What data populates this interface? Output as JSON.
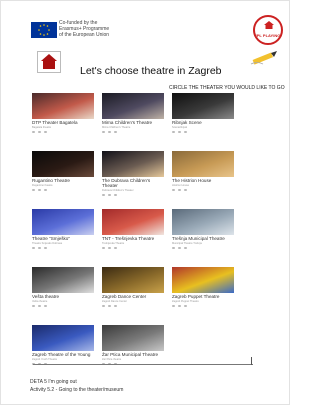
{
  "header": {
    "eu_text_lines": [
      "Co-funded by the",
      "Erasmus+ Programme",
      "of the European Union"
    ],
    "ipl_text": "IPL PLAYING",
    "title": "Let's choose theatre in Zagreb",
    "instruction": "CIRCLE THE THEATER YOU WOULD LIKE TO GO"
  },
  "theatres": [
    {
      "label": "DTP Theater Bagatela",
      "sub": "Bagatela theatre",
      "colors": [
        "#4a2a2a",
        "#c25a4a",
        "#e9d8c8"
      ]
    },
    {
      "label": "Mirna Children's Theatre",
      "sub": "Mirna Children's Theatre",
      "colors": [
        "#1b1b24",
        "#4f4a60",
        "#bfb2a6"
      ]
    },
    {
      "label": "Ribnjak Scene",
      "sub": "Scenaribnjak",
      "colors": [
        "#0f0f0f",
        "#3a3a3a",
        "#8a8a8a"
      ]
    },
    {
      "label": "Rugantino Theatre",
      "sub": "Rugantino theatre",
      "colors": [
        "#0a0a0a",
        "#2a1a14",
        "#6a4a3a"
      ]
    },
    {
      "label": "The Dubrava Children's Theater",
      "sub": "Dubrava Children's Theater",
      "colors": [
        "#111018",
        "#6b5c52",
        "#e6c89a"
      ]
    },
    {
      "label": "The Histrion House",
      "sub": "Histrion House",
      "colors": [
        "#8a6a3a",
        "#c79a55",
        "#e8c48a"
      ]
    },
    {
      "label": "Theatre \"Smješko\"",
      "sub": "Theatre Smjesko Dubrava",
      "colors": [
        "#2a3aa6",
        "#5c6fd8",
        "#c9cff0"
      ]
    },
    {
      "label": "TNT - Trešnjevka Theatre",
      "sub": "Trešnjevka Theatre",
      "colors": [
        "#a22a2a",
        "#d85a4a",
        "#f0e6e0"
      ]
    },
    {
      "label": "Trešnja Municipal Theatre",
      "sub": "Municipal Theatre Trešnja",
      "colors": [
        "#5a6a7a",
        "#9aaab8",
        "#dde4ea"
      ]
    },
    {
      "label": "Vešta theatre",
      "sub": "Vešta theatre",
      "colors": [
        "#2a2a2a",
        "#777777",
        "#e0e0e0"
      ]
    },
    {
      "label": "Zagreb Dance Center",
      "sub": "Zagreb Dance Center",
      "colors": [
        "#3a2a12",
        "#8a6a2a",
        "#c9a24a"
      ]
    },
    {
      "label": "Zagreb Puppet Theatre",
      "sub": "Zagreb Puppet Theatre",
      "colors": [
        "#b0362a",
        "#e8c020",
        "#3a6ac8"
      ]
    },
    {
      "label": "Zagreb Theatre of the Young",
      "sub": "Zagreb Youth Theatre",
      "colors": [
        "#1a2a6a",
        "#3a5ac0",
        "#a8b8e8"
      ]
    },
    {
      "label": "Žar Ptica Municipal Theatre",
      "sub": "Žar Ptica theatre",
      "colors": [
        "#3a3a3a",
        "#7a7a7a",
        "#c8c8c8"
      ]
    }
  ],
  "footer": {
    "line1": "DETA 5 I'm going out",
    "line2": "Activity 5.2 - Going to the theater/museum"
  }
}
